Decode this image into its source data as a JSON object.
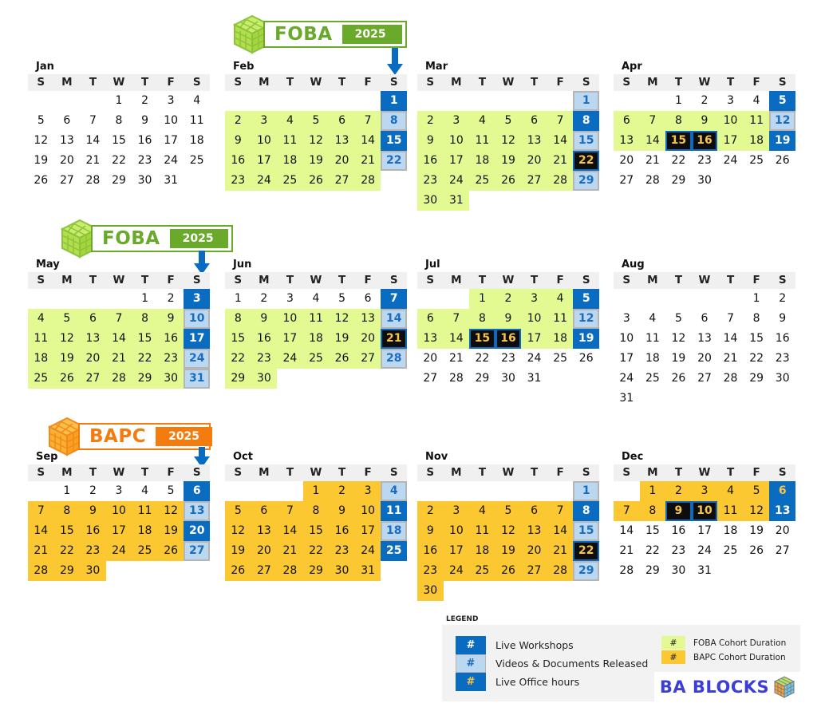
{
  "weekday_labels": [
    "S",
    "M",
    "T",
    "W",
    "T",
    "F",
    "S"
  ],
  "banners": [
    {
      "name": "FOBA",
      "year": "2025 A",
      "color": "#6aaa2a"
    },
    {
      "name": "FOBA",
      "year": "2025 B",
      "color": "#6aaa2a"
    },
    {
      "name": "BAPC",
      "year": "2025",
      "color": "#f47c0e"
    }
  ],
  "months": [
    {
      "label": "Jan",
      "offset": 3,
      "days": 31,
      "styles": {}
    },
    {
      "label": "Feb",
      "offset": 6,
      "days": 28,
      "styles": {
        "1": "workshop",
        "8": "video",
        "15": "workshop",
        "22": "video",
        "foba": [
          2,
          3,
          4,
          5,
          6,
          7,
          9,
          10,
          11,
          12,
          13,
          14,
          16,
          17,
          18,
          19,
          20,
          21,
          23,
          24,
          25,
          26,
          27,
          28
        ]
      }
    },
    {
      "label": "Mar",
      "offset": 6,
      "days": 31,
      "styles": {
        "1": "video",
        "8": "workshop",
        "15": "video",
        "22": "office",
        "29": "video",
        "foba": [
          2,
          3,
          4,
          5,
          6,
          7,
          9,
          10,
          11,
          12,
          13,
          14,
          16,
          17,
          18,
          19,
          20,
          21,
          23,
          24,
          25,
          26,
          27,
          28,
          30,
          31
        ]
      }
    },
    {
      "label": "Apr",
      "offset": 2,
      "days": 30,
      "styles": {
        "5": "workshop",
        "12": "video",
        "15": "office",
        "16": "office",
        "19": "workshop",
        "foba": [
          6,
          7,
          8,
          9,
          10,
          11,
          13,
          14,
          17,
          18
        ]
      }
    },
    {
      "label": "May",
      "offset": 4,
      "days": 31,
      "styles": {
        "3": "workshop",
        "10": "video",
        "17": "workshop",
        "24": "video",
        "31": "video",
        "foba": [
          4,
          5,
          6,
          7,
          8,
          9,
          11,
          12,
          13,
          14,
          15,
          16,
          18,
          19,
          20,
          21,
          22,
          23,
          25,
          26,
          27,
          28,
          29,
          30
        ]
      }
    },
    {
      "label": "Jun",
      "offset": 0,
      "days": 30,
      "styles": {
        "7": "workshop",
        "14": "video",
        "21": "office",
        "28": "video",
        "foba": [
          8,
          9,
          10,
          11,
          12,
          13,
          15,
          16,
          17,
          18,
          19,
          20,
          22,
          23,
          24,
          25,
          26,
          27,
          29,
          30
        ]
      }
    },
    {
      "label": "Jul",
      "offset": 2,
      "days": 31,
      "styles": {
        "5": "workshop",
        "12": "video",
        "15": "office",
        "16": "office",
        "19": "workshop",
        "foba": [
          1,
          2,
          3,
          4,
          6,
          7,
          8,
          9,
          10,
          11,
          13,
          14,
          17,
          18
        ]
      }
    },
    {
      "label": "Aug",
      "offset": 5,
      "days": 31,
      "styles": {}
    },
    {
      "label": "Sep",
      "offset": 1,
      "days": 30,
      "styles": {
        "6": "workshop",
        "13": "video",
        "20": "workshop",
        "27": "video",
        "bapc": [
          7,
          8,
          9,
          10,
          11,
          12,
          14,
          15,
          16,
          17,
          18,
          19,
          21,
          22,
          23,
          24,
          25,
          26,
          28,
          29,
          30
        ]
      }
    },
    {
      "label": "Oct",
      "offset": 3,
      "days": 31,
      "styles": {
        "4": "video",
        "11": "workshop",
        "18": "video",
        "25": "workshop",
        "bapc": [
          1,
          2,
          3,
          5,
          6,
          7,
          8,
          9,
          10,
          12,
          13,
          14,
          15,
          16,
          17,
          19,
          20,
          21,
          22,
          23,
          24,
          26,
          27,
          28,
          29,
          30,
          31
        ]
      }
    },
    {
      "label": "Nov",
      "offset": 6,
      "days": 30,
      "styles": {
        "1": "video",
        "8": "workshop",
        "15": "video",
        "22": "office",
        "29": "video",
        "bapc": [
          2,
          3,
          4,
          5,
          6,
          7,
          9,
          10,
          11,
          12,
          13,
          14,
          16,
          17,
          18,
          19,
          20,
          21,
          23,
          24,
          25,
          26,
          27,
          28,
          30
        ]
      }
    },
    {
      "label": "Dec",
      "offset": 1,
      "days": 31,
      "styles": {
        "6": "office-blue",
        "9": "office",
        "10": "office",
        "13": "workshop",
        "bapc": [
          1,
          2,
          3,
          4,
          5,
          7,
          8,
          11,
          12
        ]
      }
    }
  ],
  "legend": {
    "title": "LEGEND",
    "symbol": "#",
    "items": [
      {
        "label": "Live Workshops",
        "style": "workshop"
      },
      {
        "label": "Videos & Documents Released",
        "style": "video"
      },
      {
        "label": "Live Office hours",
        "style": "office"
      }
    ],
    "cohorts": [
      {
        "label": "FOBA Cohort Duration",
        "style": "foba",
        "color": "#e3fa93"
      },
      {
        "label": "BAPC Cohort Duration",
        "style": "bapc",
        "color": "#fcc832"
      }
    ]
  },
  "brand": {
    "name": "BA BLOCKS"
  },
  "colors": {
    "workshop": "#0a6cc0",
    "video": "#bcd8f0",
    "office": "#0d0d0d",
    "office_text": "#f7c548",
    "foba": "#e3fa93",
    "bapc": "#fcc832",
    "foba_brand": "#6aaa2a",
    "bapc_brand": "#f47c0e"
  }
}
